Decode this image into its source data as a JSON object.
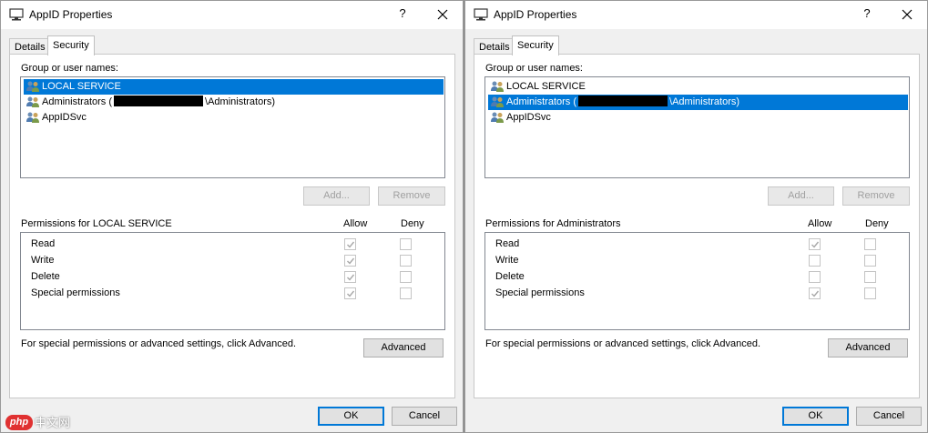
{
  "dialogs": [
    {
      "title": "AppID Properties",
      "tabs": [
        "Details",
        "Security"
      ],
      "active_tab": "Security",
      "group_label": "Group or user names:",
      "users": [
        {
          "name": "LOCAL SERVICE",
          "selected": true
        },
        {
          "prefix": "Administrators (",
          "redacted": true,
          "suffix": "\\Administrators)",
          "selected": false
        },
        {
          "name": "AppIDSvc",
          "selected": false
        }
      ],
      "add_label": "Add...",
      "remove_label": "Remove",
      "permissions_label": "Permissions for LOCAL SERVICE",
      "allow_label": "Allow",
      "deny_label": "Deny",
      "permissions": [
        {
          "name": "Read",
          "allow": true,
          "deny": false
        },
        {
          "name": "Write",
          "allow": true,
          "deny": false
        },
        {
          "name": "Delete",
          "allow": true,
          "deny": false
        },
        {
          "name": "Special permissions",
          "allow": true,
          "deny": false
        }
      ],
      "advanced_note": "For special permissions or advanced settings, click Advanced.",
      "advanced_label": "Advanced",
      "ok_label": "OK",
      "cancel_label": "Cancel",
      "help_glyph": "?"
    },
    {
      "title": "AppID Properties",
      "tabs": [
        "Details",
        "Security"
      ],
      "active_tab": "Security",
      "group_label": "Group or user names:",
      "users": [
        {
          "name": "LOCAL SERVICE",
          "selected": false
        },
        {
          "prefix": "Administrators (",
          "redacted": true,
          "suffix": "\\Administrators)",
          "selected": true
        },
        {
          "name": "AppIDSvc",
          "selected": false
        }
      ],
      "add_label": "Add...",
      "remove_label": "Remove",
      "permissions_label": "Permissions for Administrators",
      "allow_label": "Allow",
      "deny_label": "Deny",
      "permissions": [
        {
          "name": "Read",
          "allow": true,
          "deny": false
        },
        {
          "name": "Write",
          "allow": false,
          "deny": false
        },
        {
          "name": "Delete",
          "allow": false,
          "deny": false
        },
        {
          "name": "Special permissions",
          "allow": true,
          "deny": false
        }
      ],
      "advanced_note": "For special permissions or advanced settings, click Advanced.",
      "advanced_label": "Advanced",
      "ok_label": "OK",
      "cancel_label": "Cancel",
      "help_glyph": "?"
    }
  ],
  "watermark": {
    "badge": "php",
    "text": "中文网"
  },
  "colors": {
    "selection": "#0078d7",
    "dialog_bg": "#f0f0f0",
    "default_button_border": "#0078d7"
  }
}
